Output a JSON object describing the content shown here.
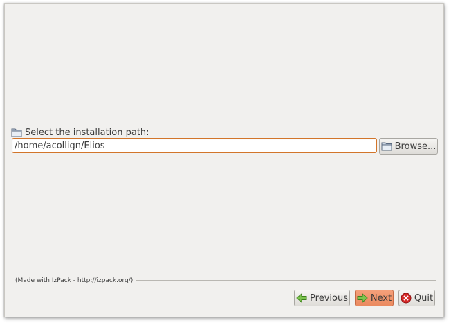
{
  "install": {
    "path_label": "Select the installation path:",
    "path_value": "/home/acollign/Elios",
    "browse_label": "Browse..."
  },
  "footer": {
    "made_with": "(Made with IzPack - http://izpack.org/)"
  },
  "nav": {
    "previous_label": "Previous",
    "next_label": "Next",
    "quit_label": "Quit"
  },
  "icons": {
    "path_label_icon": "folder-icon",
    "browse_icon": "folder-icon",
    "previous_icon": "arrow-left-icon",
    "next_icon": "arrow-right-icon",
    "quit_icon": "close-circle-icon"
  },
  "colors": {
    "input_focus_border": "#d2752a",
    "next_button": "#ea8a5f",
    "arrow_green": "#5fae3a",
    "quit_red": "#d62a2a"
  }
}
